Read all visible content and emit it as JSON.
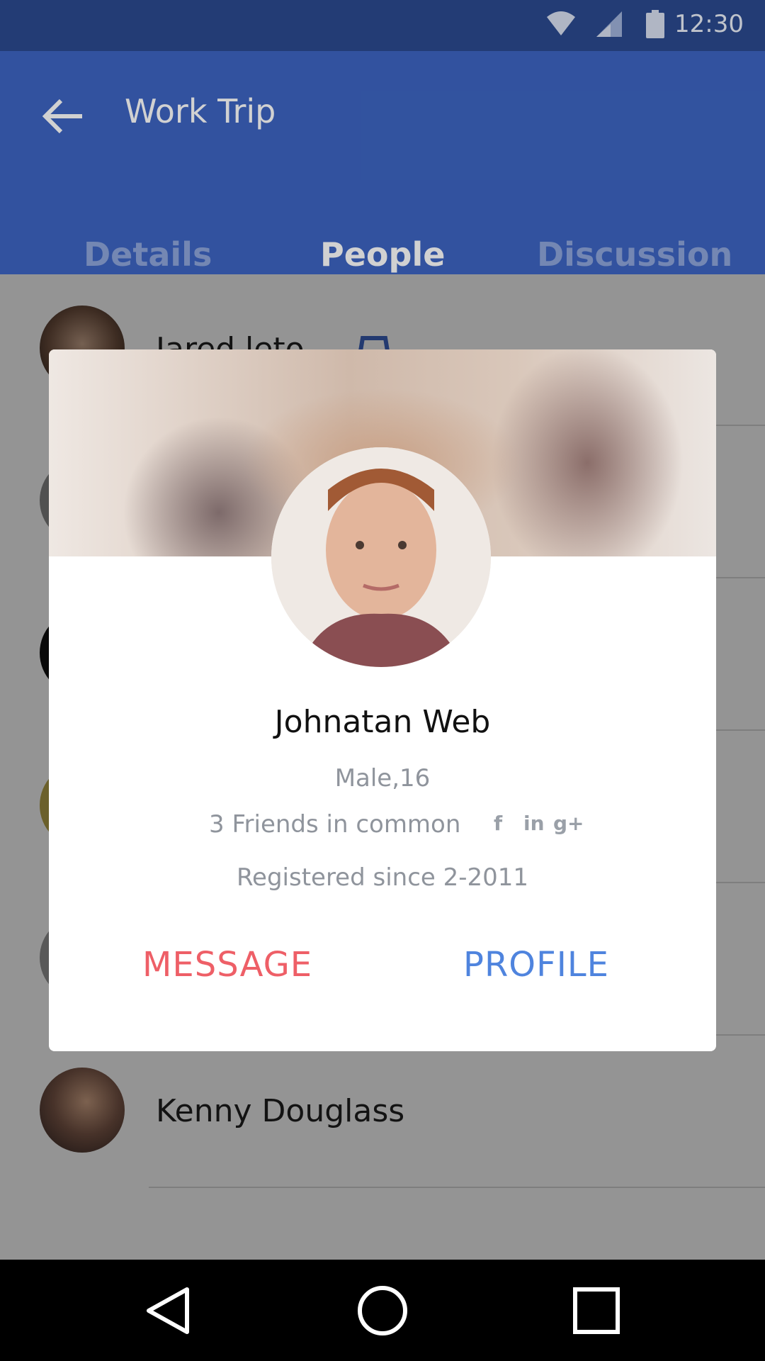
{
  "status_bar": {
    "time": "12:30"
  },
  "app_bar": {
    "title": "Work Trip"
  },
  "tabs": [
    {
      "label": "Details"
    },
    {
      "label": "People",
      "selected": true
    },
    {
      "label": "Discussion"
    }
  ],
  "people": [
    {
      "name": "Jared leto"
    },
    {
      "name": ""
    },
    {
      "name": ""
    },
    {
      "name": ""
    },
    {
      "name": ""
    },
    {
      "name": "Kenny Douglass"
    }
  ],
  "dialog": {
    "name": "Johnatan Web",
    "gender_age": "Male,16",
    "friends_in_common": "3 Friends in common",
    "social_icons": [
      "facebook-icon",
      "linkedin-icon",
      "google-plus-icon"
    ],
    "registered": "Registered since 2-2011",
    "message_label": "MESSAGE",
    "profile_label": "PROFILE",
    "colors": {
      "message": "#ee5f67",
      "profile": "#4f84de"
    }
  },
  "theme": {
    "primary": "#3d65c2",
    "status_bar": "#2b4a8f"
  }
}
